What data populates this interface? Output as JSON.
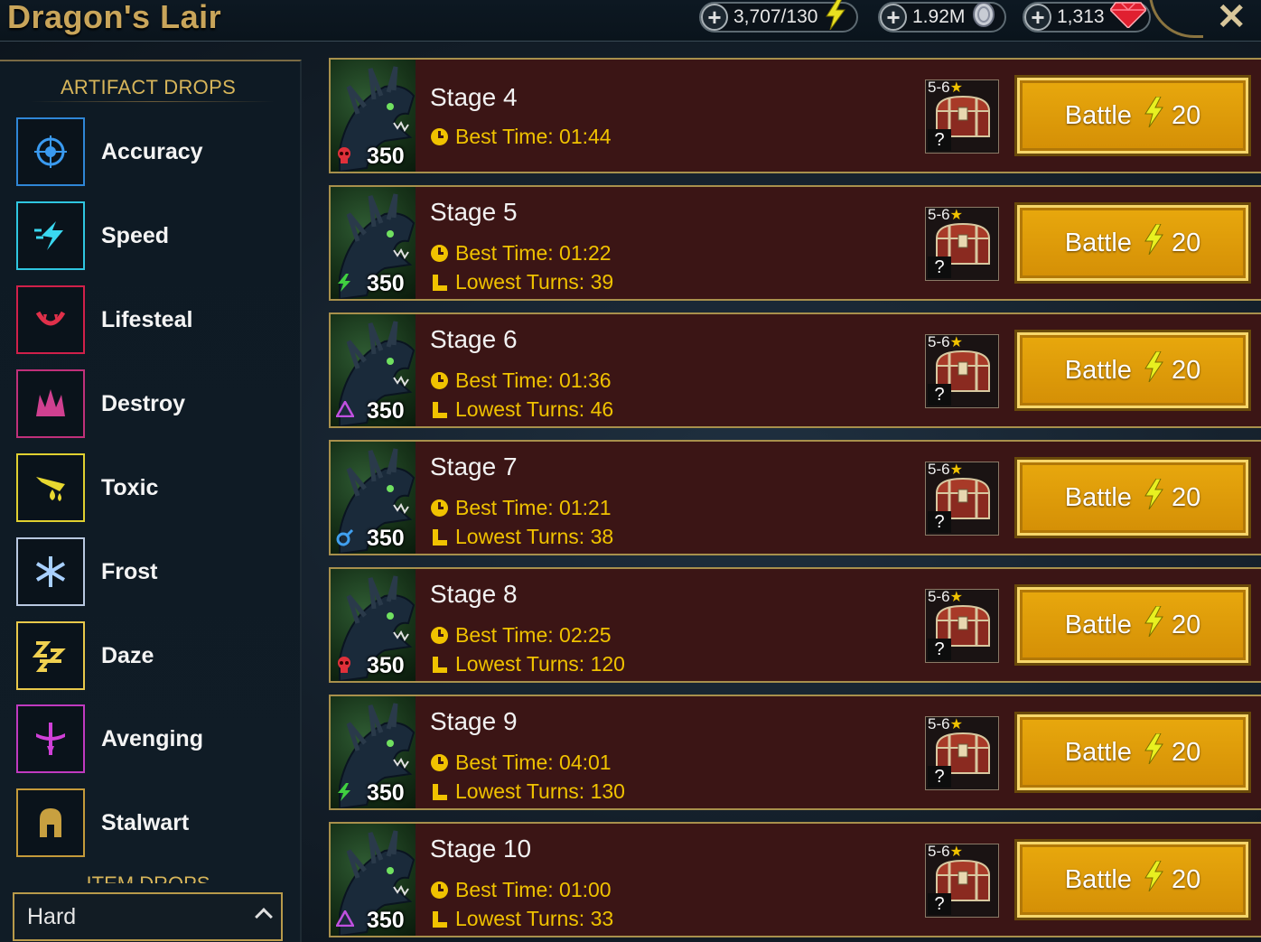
{
  "header": {
    "title": "Dragon's Lair",
    "energy": "3,707/130",
    "silver": "1.92M",
    "gems": "1,313",
    "close_label": "✕"
  },
  "sidebar": {
    "heading": "ARTIFACT DROPS",
    "items": [
      {
        "label": "Accuracy",
        "icon": "accuracy-icon",
        "color": "#2f86d6"
      },
      {
        "label": "Speed",
        "icon": "speed-icon",
        "color": "#2fc6e0"
      },
      {
        "label": "Lifesteal",
        "icon": "lifesteal-icon",
        "color": "#d0204a"
      },
      {
        "label": "Destroy",
        "icon": "destroy-icon",
        "color": "#c0307a"
      },
      {
        "label": "Toxic",
        "icon": "toxic-icon",
        "color": "#e0d030"
      },
      {
        "label": "Frost",
        "icon": "frost-icon",
        "color": "#b8c8e0"
      },
      {
        "label": "Daze",
        "icon": "daze-icon",
        "color": "#e8c84a"
      },
      {
        "label": "Avenging",
        "icon": "avenging-icon",
        "color": "#c03ac0"
      },
      {
        "label": "Stalwart",
        "icon": "stalwart-icon",
        "color": "#c49a3a"
      }
    ],
    "item_drops_heading": "ITEM DROPS",
    "difficulty": "Hard"
  },
  "stages": [
    {
      "name": "Stage 4",
      "power": "350",
      "affinity": "force",
      "best_time": "Best Time: 01:44",
      "lowest_turns": null
    },
    {
      "name": "Stage 5",
      "power": "350",
      "affinity": "spirit",
      "best_time": "Best Time: 01:22",
      "lowest_turns": "Lowest Turns: 39"
    },
    {
      "name": "Stage 6",
      "power": "350",
      "affinity": "void",
      "best_time": "Best Time: 01:36",
      "lowest_turns": "Lowest Turns: 46"
    },
    {
      "name": "Stage 7",
      "power": "350",
      "affinity": "magic",
      "best_time": "Best Time: 01:21",
      "lowest_turns": "Lowest Turns: 38"
    },
    {
      "name": "Stage 8",
      "power": "350",
      "affinity": "force",
      "best_time": "Best Time: 02:25",
      "lowest_turns": "Lowest Turns: 120"
    },
    {
      "name": "Stage 9",
      "power": "350",
      "affinity": "spirit",
      "best_time": "Best Time: 04:01",
      "lowest_turns": "Lowest Turns: 130"
    },
    {
      "name": "Stage 10",
      "power": "350",
      "affinity": "void",
      "best_time": "Best Time: 01:00",
      "lowest_turns": "Lowest Turns: 33"
    }
  ],
  "loot": {
    "rank": "5-6",
    "unknown": "?"
  },
  "battle": {
    "label": "Battle",
    "cost": "20"
  },
  "colors": {
    "accent": "#e8a80d",
    "stat": "#f0c200",
    "row_bg": "#3b1515"
  }
}
